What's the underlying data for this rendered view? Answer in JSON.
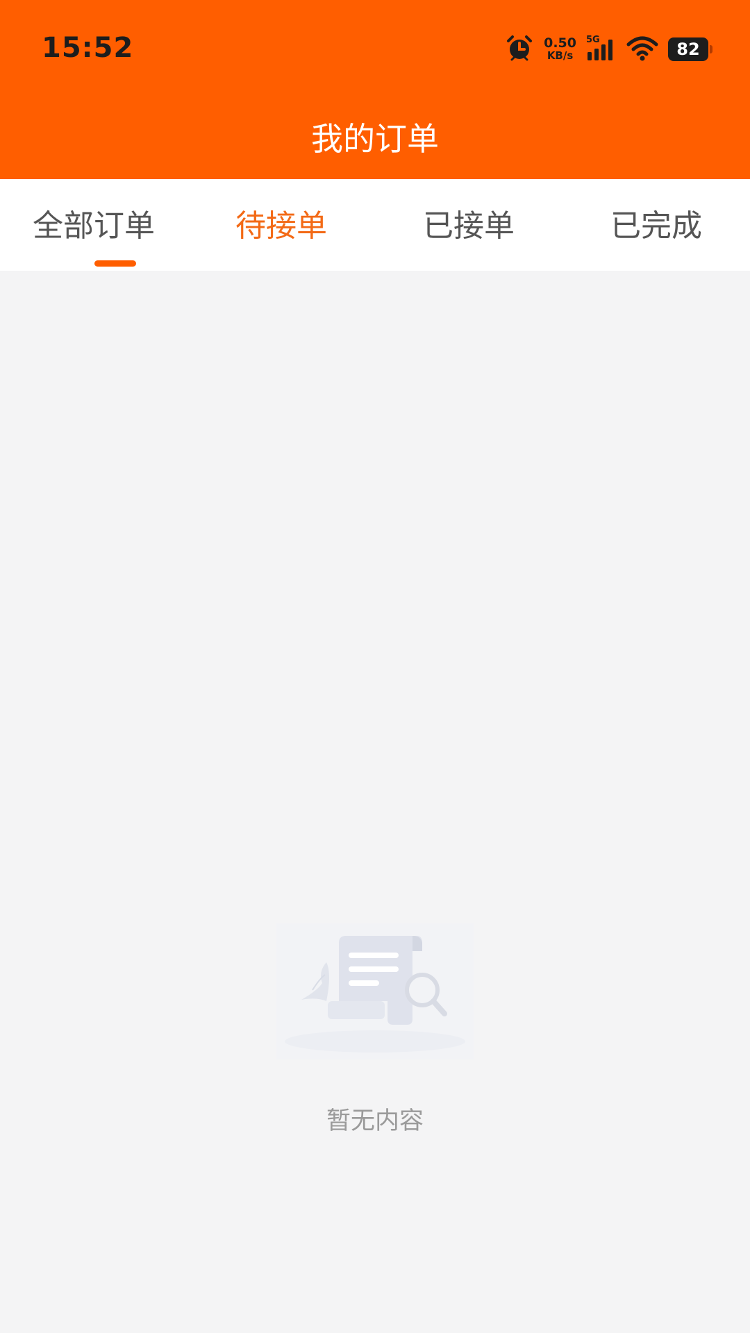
{
  "status_bar": {
    "time": "15:52",
    "net_speed_value": "0.50",
    "net_speed_unit": "KB/s",
    "network_type": "5G",
    "battery_level": "82",
    "icons": [
      "alarm-icon",
      "signal-icon",
      "wifi-icon",
      "battery-icon"
    ]
  },
  "header": {
    "title": "我的订单",
    "background_color": "#ff5e00"
  },
  "tabs": [
    {
      "label": "全部订单",
      "selected": true
    },
    {
      "label": "待接单",
      "highlighted": true
    },
    {
      "label": "已接单"
    },
    {
      "label": "已完成"
    }
  ],
  "colors": {
    "accent": "#ff5e00",
    "highlight_text": "#f36a16",
    "page_background": "#f4f4f5"
  },
  "empty_state": {
    "icon": "empty-document-search-icon",
    "message": "暂无内容"
  }
}
